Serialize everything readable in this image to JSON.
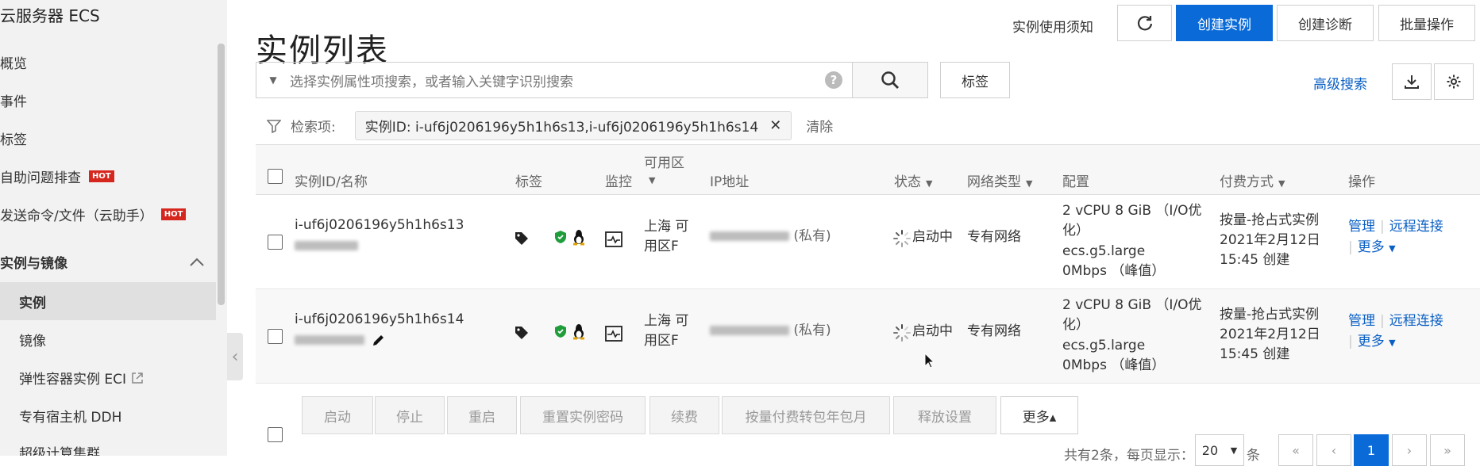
{
  "sidebar": {
    "title": "云服务器 ECS",
    "items": [
      {
        "label": "概览"
      },
      {
        "label": "事件"
      },
      {
        "label": "标签"
      },
      {
        "label": "自助问题排查",
        "badge": "HOT"
      },
      {
        "label": "发送命令/文件（云助手）",
        "badge": "HOT"
      }
    ],
    "section": "实例与镜像",
    "sub_items": [
      {
        "label": "实例"
      },
      {
        "label": "镜像"
      },
      {
        "label": "弹性容器实例 ECI"
      },
      {
        "label": "专有宿主机 DDH"
      },
      {
        "label": "超级计算集群"
      }
    ]
  },
  "header": {
    "title": "实例列表",
    "notice": "实例使用须知",
    "refresh_icon": "refresh-icon",
    "create": "创建实例",
    "diagnose": "创建诊断",
    "batch": "批量操作"
  },
  "search": {
    "placeholder": "选择实例属性项搜索，或者输入关键字识别搜索",
    "help": "?",
    "tag_button": "标签",
    "advanced": "高级搜索"
  },
  "filter": {
    "label": "检索项:",
    "chip": "实例ID: i-uf6j0206196y5h1h6s13,i-uf6j0206196y5h1h6s14",
    "clear": "清除"
  },
  "table": {
    "headers": {
      "id": "实例ID/名称",
      "tag": "标签",
      "monitor": "监控",
      "zone": "可用区",
      "ip": "IP地址",
      "status": "状态",
      "network": "网络类型",
      "config": "配置",
      "billing": "付费方式",
      "ops": "操作"
    },
    "rows": [
      {
        "id": "i-uf6j0206196y5h1h6s13",
        "zone_line1": "上海 可",
        "zone_line2": "用区F",
        "ip_suffix": "(私有)",
        "status": "启动中",
        "network": "专有网络",
        "config_line1": "2 vCPU 8 GiB （I/O优",
        "config_line2": "化）",
        "config_type": "ecs.g5.large",
        "bandwidth": "0Mbps （峰值）",
        "billing_line1": "按量-抢占式实例",
        "billing_line2": "2021年2月12日",
        "billing_line3": "15:45 创建",
        "op_manage": "管理",
        "op_remote": "远程连接",
        "op_more": "更多"
      },
      {
        "id": "i-uf6j0206196y5h1h6s14",
        "zone_line1": "上海 可",
        "zone_line2": "用区F",
        "ip_suffix": "(私有)",
        "status": "启动中",
        "network": "专有网络",
        "config_line1": "2 vCPU 8 GiB （I/O优",
        "config_line2": "化）",
        "config_type": "ecs.g5.large",
        "bandwidth": "0Mbps （峰值）",
        "billing_line1": "按量-抢占式实例",
        "billing_line2": "2021年2月12日",
        "billing_line3": "15:45 创建",
        "op_manage": "管理",
        "op_remote": "远程连接",
        "op_more": "更多"
      }
    ]
  },
  "actions": {
    "start": "启动",
    "stop": "停止",
    "restart": "重启",
    "reset_password": "重置实例密码",
    "renew": "续费",
    "convert": "按量付费转包年包月",
    "release": "释放设置",
    "more": "更多▴"
  },
  "pagination": {
    "summary": "共有2条，每页显示：",
    "page_size": "20",
    "unit": "条",
    "current_page": "1"
  },
  "colors": {
    "primary": "#0a6ad8",
    "link": "#0a5fc4",
    "hot": "#d6271e"
  }
}
